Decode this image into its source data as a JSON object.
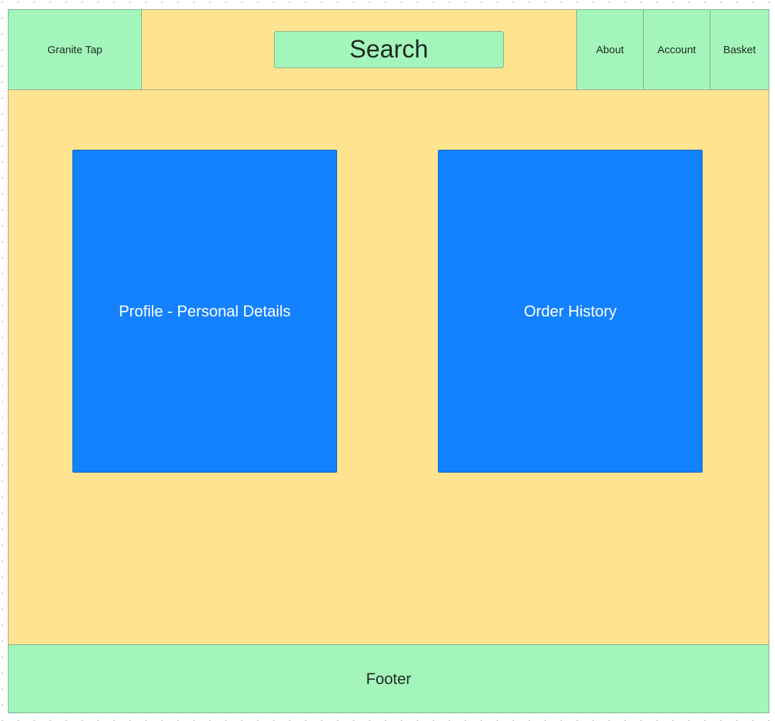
{
  "header": {
    "logo_label": "Granite Tap",
    "search_label": "Search",
    "nav": [
      {
        "label": "About"
      },
      {
        "label": "Account"
      },
      {
        "label": "Basket"
      }
    ]
  },
  "main": {
    "cards": [
      {
        "label": "Profile - Personal Details"
      },
      {
        "label": "Order History"
      }
    ]
  },
  "footer": {
    "label": "Footer"
  },
  "colors": {
    "green_block": "#a3f5bb",
    "yellow_area": "#fee490",
    "blue_card": "#1482fe",
    "card_text": "#ffffff"
  }
}
